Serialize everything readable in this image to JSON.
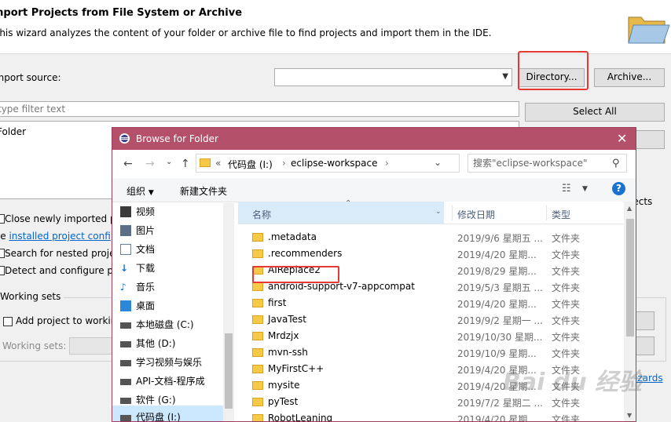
{
  "wizard": {
    "title": "Import Projects from File System or Archive",
    "description": "This wizard analyzes the content of your folder or archive file to find projects and import them in the IDE.",
    "import_source_label": "Import source:",
    "directory_button": "Directory...",
    "archive_button": "Archive...",
    "filter_placeholder": "type filter text",
    "select_all_button": "Select All",
    "project_row": "Folder",
    "projects_suffix": "jects",
    "options": [
      {
        "label": "Close newly imported p"
      },
      {
        "label": "Search for nested proje"
      },
      {
        "label": "Detect and configure pr"
      }
    ],
    "use_prefix": "se ",
    "installed_link": "installed project confi",
    "working_sets": {
      "legend": "Working sets",
      "add_label": "Add project to workin",
      "sets_label": "Working sets:"
    },
    "wizards_link": "izards"
  },
  "dialog": {
    "title": "Browse for Folder",
    "breadcrumb": {
      "sep": "«",
      "drive": "代码盘 (I:)",
      "folder": "eclipse-workspace"
    },
    "search_placeholder": "搜索\"eclipse-workspace\"",
    "toolbar": {
      "organize": "组织",
      "new_folder": "新建文件夹"
    },
    "nav_items": [
      {
        "label": "视频",
        "icon": "video-icon",
        "color": "#3a3a3a"
      },
      {
        "label": "图片",
        "icon": "picture-icon",
        "color": "#5a6f86"
      },
      {
        "label": "文档",
        "icon": "document-icon",
        "color": "#6d7d90"
      },
      {
        "label": "下载",
        "icon": "download-icon",
        "color": "#1a73d1"
      },
      {
        "label": "音乐",
        "icon": "music-icon",
        "color": "#1a73d1"
      },
      {
        "label": "桌面",
        "icon": "desktop-icon",
        "color": "#2b88d8"
      },
      {
        "label": "本地磁盘 (C:)",
        "icon": "drive-icon",
        "color": "#555555"
      },
      {
        "label": "其他 (D:)",
        "icon": "drive-icon",
        "color": "#555555"
      },
      {
        "label": "学习视频与娱乐",
        "icon": "drive-icon",
        "color": "#555555"
      },
      {
        "label": "API-文档-程序成",
        "icon": "drive-icon",
        "color": "#555555"
      },
      {
        "label": "软件 (G:)",
        "icon": "drive-icon",
        "color": "#555555"
      },
      {
        "label": "代码盘 (I:)",
        "icon": "drive-icon",
        "color": "#555555"
      }
    ],
    "columns": {
      "name": "名称",
      "date": "修改日期",
      "type": "类型"
    },
    "files": [
      {
        "name": ".metadata",
        "date": "2019/9/6 星期五 ...",
        "type": "文件夹"
      },
      {
        "name": ".recommenders",
        "date": "2019/4/20 星期...",
        "type": "文件夹"
      },
      {
        "name": "AIReplace2",
        "date": "2019/8/29 星期...",
        "type": "文件夹"
      },
      {
        "name": "android-support-v7-appcompat",
        "date": "2019/5/3 星期五 ...",
        "type": "文件夹"
      },
      {
        "name": "first",
        "date": "2019/4/20 星期...",
        "type": "文件夹"
      },
      {
        "name": "JavaTest",
        "date": "2019/9/2 星期一 ...",
        "type": "文件夹"
      },
      {
        "name": "Mrdzjx",
        "date": "2019/10/30 星期...",
        "type": "文件夹"
      },
      {
        "name": "mvn-ssh",
        "date": "2019/10/9 星期...",
        "type": "文件夹"
      },
      {
        "name": "MyFirstC++",
        "date": "2019/4/20 星期...",
        "type": "文件夹"
      },
      {
        "name": "mysite",
        "date": "2019/4/20 星期...",
        "type": "文件夹"
      },
      {
        "name": "pyTest",
        "date": "2019/7/2 星期二 ...",
        "type": "文件夹"
      },
      {
        "name": "RobotLeaning",
        "date": "2019/4/20 星期...",
        "type": "文件夹"
      }
    ],
    "watermark": "Bai du 经验"
  },
  "colors": {
    "dialog_title_bar": "#b5506b",
    "highlight": "#e53935",
    "link": "#0066cc",
    "selection": "#cce8ff"
  }
}
